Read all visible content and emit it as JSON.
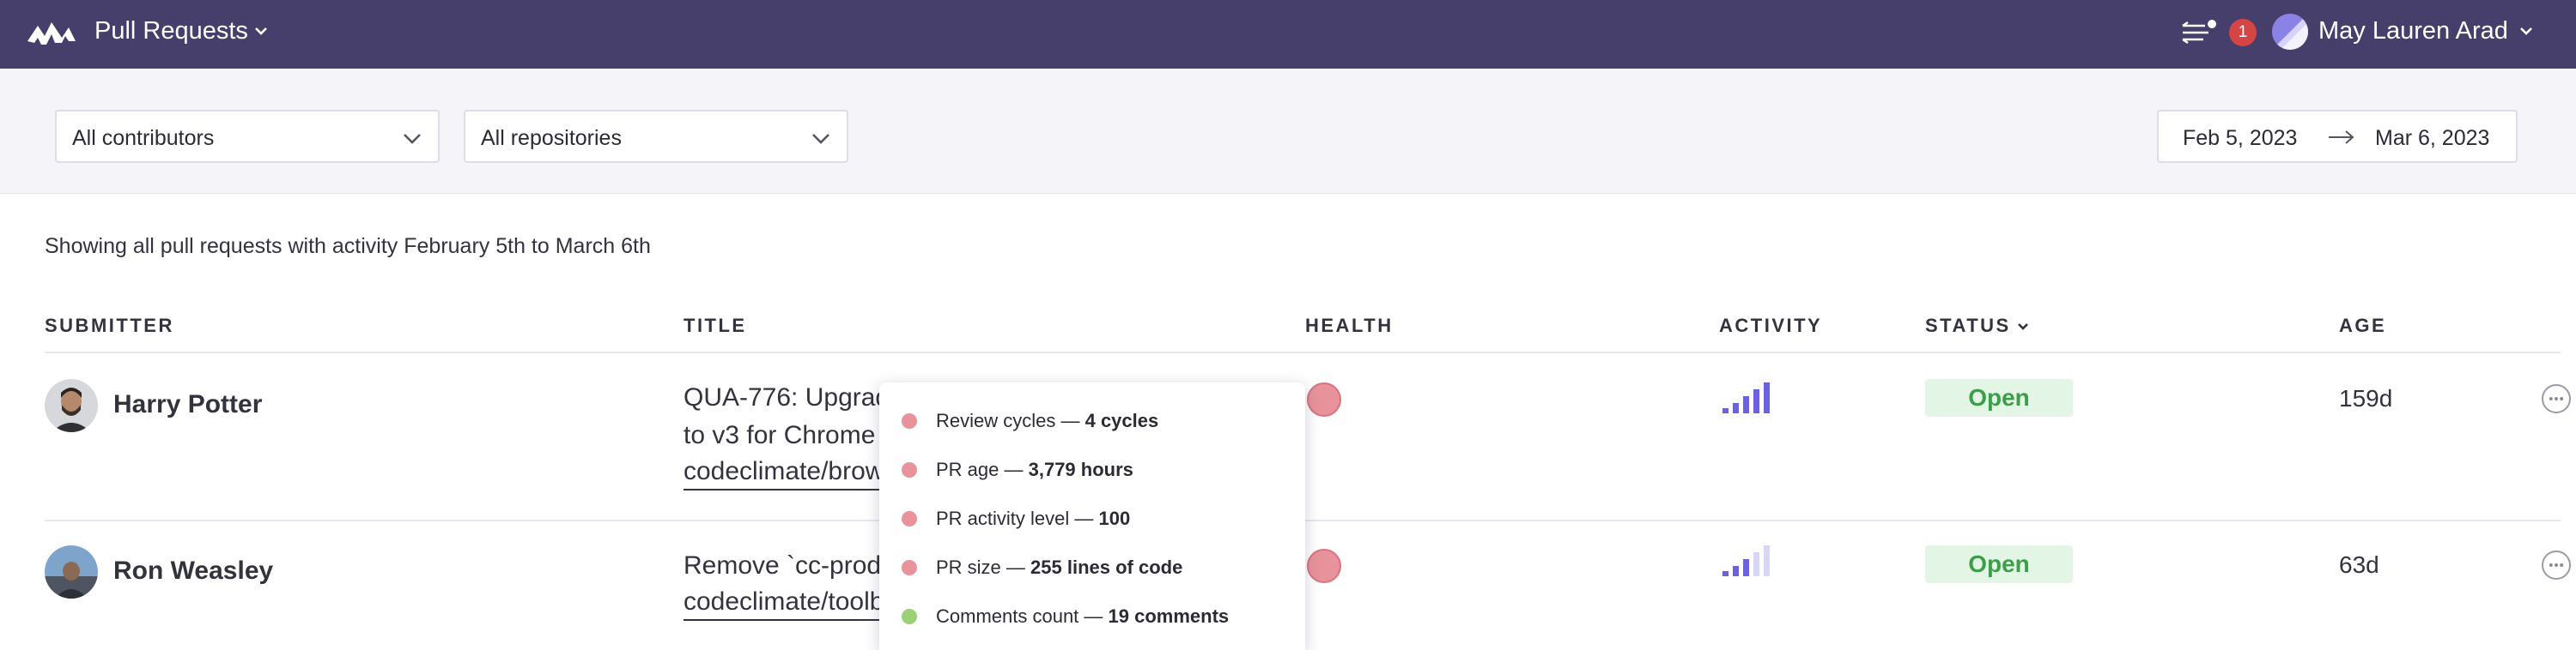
{
  "header": {
    "app_title": "Pull Requests",
    "notification_count": "1",
    "user_name": "May Lauren Arad",
    "bg_color": "#463f6b"
  },
  "filters": {
    "contributors": "All contributors",
    "repositories": "All repositories",
    "date_from": "Feb 5, 2023",
    "date_to": "Mar 6, 2023"
  },
  "summary": "Showing all pull requests with activity February 5th to March 6th",
  "columns": {
    "submitter": "SUBMITTER",
    "title": "TITLE",
    "health": "HEALTH",
    "activity": "ACTIVITY",
    "status": "STATUS",
    "age": "AGE"
  },
  "rows": [
    {
      "submitter": "Harry Potter",
      "title_line1": "QUA-776: Upgrade",
      "title_line2": "to v3 for Chrome",
      "repo": "codeclimate/browser",
      "health": "poor",
      "activity_level": 5,
      "status": "Open",
      "age": "159d"
    },
    {
      "submitter": "Ron Weasley",
      "title_line1": "Remove `cc-production",
      "repo": "codeclimate/toolbar",
      "health": "poor",
      "activity_level": 3,
      "status": "Open",
      "age": "63d"
    }
  ],
  "tooltip": {
    "items": [
      {
        "label": "Review cycles — ",
        "value": "4 cycles",
        "color": "#e8939c"
      },
      {
        "label": "PR age — ",
        "value": "3,779 hours",
        "color": "#e8939c"
      },
      {
        "label": "PR activity level — ",
        "value": "100",
        "color": "#e8939c"
      },
      {
        "label": "PR size — ",
        "value": "255 lines of code",
        "color": "#e8939c"
      },
      {
        "label": "Comments count — ",
        "value": "19 comments",
        "color": "#9ad176"
      }
    ]
  },
  "colors": {
    "accent": "#6c63d8",
    "status_open_bg": "#e3f5e5",
    "status_open_text": "#3d9e4a",
    "health_poor": "#e8939c"
  }
}
